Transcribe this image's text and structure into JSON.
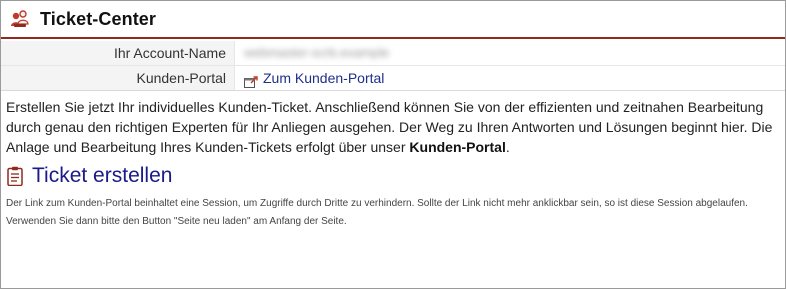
{
  "header": {
    "title": "Ticket-Center",
    "icon": "support-agents-icon"
  },
  "account": {
    "label": "Ihr Account-Name",
    "value": "webmaster-scrb.example"
  },
  "portal": {
    "label": "Kunden-Portal",
    "link_text": "Zum Kunden-Portal",
    "icon": "external-window-icon"
  },
  "intro": {
    "text_before": "Erstellen Sie jetzt Ihr individuelles Kunden-Ticket. Anschließend können Sie von der effizienten und zeitnahen Bearbeitung durch genau den richtigen Experten für Ihr Anliegen ausgehen. Der Weg zu Ihren Antworten und Lösungen beginnt hier. Die Anlage und Bearbeitung Ihres Kunden-Tickets erfolgt über unser ",
    "bold": "Kunden-Portal",
    "text_after": "."
  },
  "section": {
    "title": "Ticket erstellen",
    "icon": "clipboard-icon",
    "note": "Der Link zum Kunden-Portal beinhaltet eine Session, um Zugriffe durch Dritte zu verhindern. Sollte der Link nicht mehr anklickbar sein, so ist diese Session abgelaufen. Verwenden Sie dann bitte den Button \"Seite neu laden\" am Anfang der Seite."
  },
  "colors": {
    "header_rule": "#8f2a1f",
    "link": "#1f2f8a",
    "section_title": "#1a1a8a"
  }
}
